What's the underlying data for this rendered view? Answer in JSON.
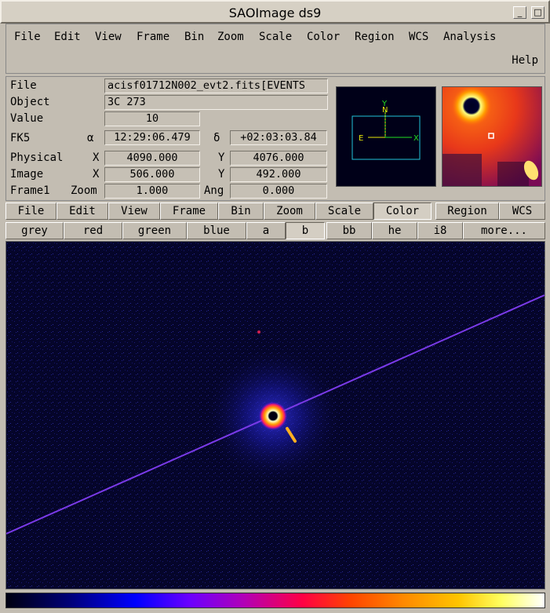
{
  "window": {
    "title": "SAOImage ds9",
    "buttons": [
      "_",
      "□"
    ]
  },
  "menubar": {
    "items": [
      "File",
      "Edit",
      "View",
      "Frame",
      "Bin",
      "Zoom",
      "Scale",
      "Color",
      "Region",
      "WCS",
      "Analysis"
    ],
    "help": "Help"
  },
  "info": {
    "file_label": "File",
    "file_value": "acisf01712N002_evt2.fits[EVENTS",
    "object_label": "Object",
    "object_value": "3C 273",
    "value_label": "Value",
    "value_value": "10",
    "fk5_label": "FK5",
    "alpha_symbol": "α",
    "alpha_value": "12:29:06.479",
    "delta_symbol": "δ",
    "delta_value": "+02:03:03.84",
    "physical_label": "Physical",
    "physical_x_label": "X",
    "physical_x": "4090.000",
    "physical_y_label": "Y",
    "physical_y": "4076.000",
    "image_label": "Image",
    "image_x_label": "X",
    "image_x": "506.000",
    "image_y_label": "Y",
    "image_y": "492.000",
    "frame_label": "Frame1",
    "zoom_label": "Zoom",
    "zoom_value": "1.000",
    "ang_label": "Ang",
    "ang_value": "0.000"
  },
  "panner": {
    "n_label": "N",
    "e_label": "E",
    "x_label": "X",
    "y_label": "Y"
  },
  "button_bar": {
    "major": [
      "File",
      "Edit",
      "View",
      "Frame",
      "Bin",
      "Zoom",
      "Scale",
      "Color",
      "Region",
      "WCS"
    ],
    "active_major": "Color",
    "color": [
      "grey",
      "red",
      "green",
      "blue",
      "a",
      "b",
      "bb",
      "he",
      "i8",
      "more..."
    ],
    "active_color": "b"
  },
  "colors": {
    "background": "#c3bdb2",
    "image_bg": "#05052a"
  }
}
